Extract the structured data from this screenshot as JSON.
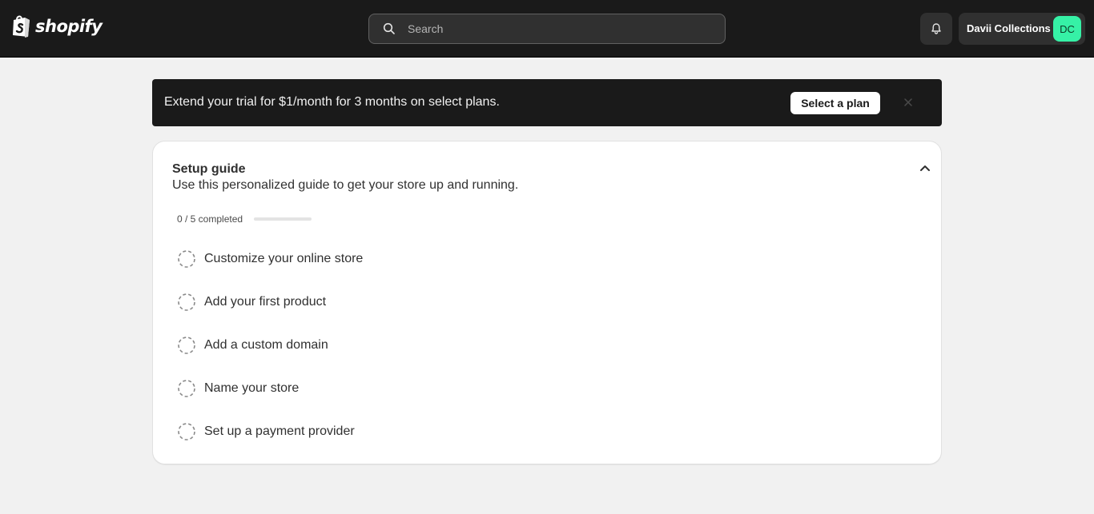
{
  "topbar": {
    "logo_text": "shopify",
    "search": {
      "placeholder": "Search",
      "value": ""
    },
    "notifications_icon": "bell-icon",
    "store": {
      "name": "Davii Collections",
      "initials": "DC",
      "avatar_color": "#36f1a6"
    }
  },
  "banner": {
    "text": "Extend your trial for $1/month for 3 months on select plans.",
    "cta_label": "Select a plan",
    "close_icon": "close-icon"
  },
  "setup_guide": {
    "title": "Setup guide",
    "subtitle": "Use this personalized guide to get your store up and running.",
    "collapse_icon": "chevron-up-icon",
    "progress": {
      "label": "0 / 5 completed",
      "completed": 0,
      "total": 5
    },
    "tasks": [
      {
        "label": "Customize your online store",
        "done": false
      },
      {
        "label": "Add your first product",
        "done": false
      },
      {
        "label": "Add a custom domain",
        "done": false
      },
      {
        "label": "Name your store",
        "done": false
      },
      {
        "label": "Set up a payment provider",
        "done": false
      }
    ]
  },
  "colors": {
    "topbar_bg": "#1a1a1a",
    "page_bg": "#f1f1f1",
    "accent_green": "#36f1a6"
  }
}
